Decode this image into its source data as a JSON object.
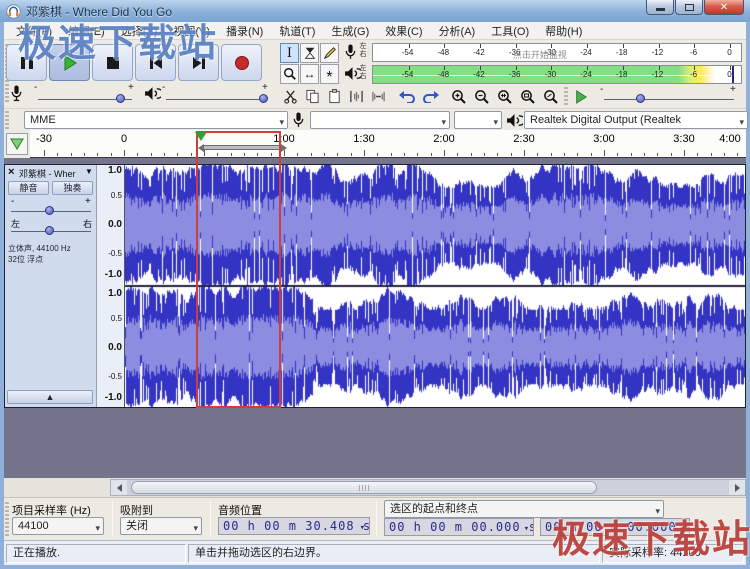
{
  "window": {
    "title": "邓紫棋 - Where Did You Go"
  },
  "menu": {
    "items": [
      "文件(F)",
      "编辑(E)",
      "选择(S)",
      "视图(V)",
      "播录(N)",
      "轨道(T)",
      "生成(G)",
      "效果(C)",
      "分析(A)",
      "工具(O)",
      "帮助(H)"
    ]
  },
  "meters": {
    "record_hint": "点击开始监视",
    "ticks": [
      "-54",
      "-48",
      "-42",
      "-36",
      "-30",
      "-24",
      "-18",
      "-12",
      "-6",
      "0"
    ],
    "channel_top": "左",
    "channel_bottom": "右"
  },
  "device": {
    "host": "MME",
    "input": "",
    "channels": "",
    "output": "Realtek Digital Output (Realtek"
  },
  "timeline": {
    "labels": [
      [
        "-30",
        -30
      ],
      [
        "0",
        0
      ],
      [
        "1:00",
        60
      ],
      [
        "1:30",
        90
      ],
      [
        "2:00",
        120
      ],
      [
        "2:30",
        150
      ],
      [
        "3:00",
        180
      ],
      [
        "3:30",
        210
      ],
      [
        "4:00",
        240
      ]
    ]
  },
  "track": {
    "close": "×",
    "name": "邓紫棋 - Wher",
    "caret": "▼",
    "mute_label": "静音",
    "solo_label": "独奏",
    "gain_min": "-",
    "gain_max": "+",
    "pan_left": "左",
    "pan_right": "右",
    "info_line1": "立体声, 44100 Hz",
    "info_line2": "32位 浮点",
    "scale": [
      "1.0",
      "0.5",
      "0.0",
      "-0.5",
      "-1.0"
    ],
    "collapse": "▲"
  },
  "selection_bar": {
    "rate_label": "项目采样率 (Hz)",
    "rate_value": "44100",
    "snap_label": "吸附到",
    "snap_value": "关闭",
    "position_label": "音频位置",
    "position_value": "00 h 00 m 30.408 s",
    "range_label": "选区的起点和终点",
    "sel_start": "00 h 00 m 00.000 s",
    "sel_end": "00 h 00 m 00.000 s"
  },
  "status": {
    "state": "正在播放.",
    "hint": "单击并拖动选区的右边界。",
    "rate": "实际采样率: 44100"
  },
  "watermark": {
    "text": "极速下载站"
  },
  "colors": {
    "wave_blue": "#3434c4",
    "wave_rms": "#8c8ce0",
    "meter_green": "#82e082",
    "annotation_red": "#cf3d3d",
    "area_bg": "#74748c"
  }
}
